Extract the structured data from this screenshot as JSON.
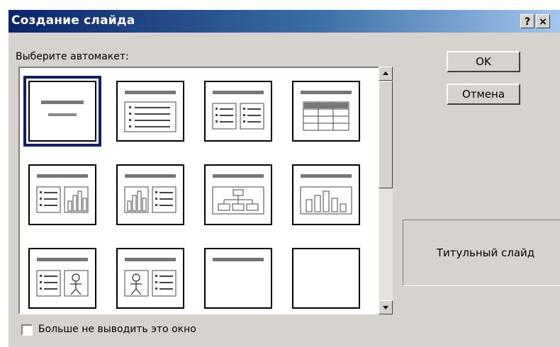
{
  "dialog": {
    "title": "Создание слайда",
    "help_label": "?",
    "close_label": "×",
    "choose_layout_label": "Выберите автомакет:",
    "ok_label": "OK",
    "cancel_label": "Отмена",
    "preview_caption": "Титульный слайд",
    "dont_show_label": "Больше не выводить это окно",
    "dont_show_checked": false
  },
  "layouts": [
    {
      "type": "title-slide",
      "selected": true
    },
    {
      "type": "bulleted-list",
      "selected": false
    },
    {
      "type": "two-column-text",
      "selected": false
    },
    {
      "type": "table",
      "selected": false
    },
    {
      "type": "text-and-chart",
      "selected": false
    },
    {
      "type": "chart-and-text",
      "selected": false
    },
    {
      "type": "organization-chart",
      "selected": false
    },
    {
      "type": "chart",
      "selected": false
    },
    {
      "type": "text-and-clip-art",
      "selected": false
    },
    {
      "type": "clip-art-and-text",
      "selected": false
    },
    {
      "type": "title-only",
      "selected": false
    },
    {
      "type": "blank",
      "selected": false
    }
  ]
}
